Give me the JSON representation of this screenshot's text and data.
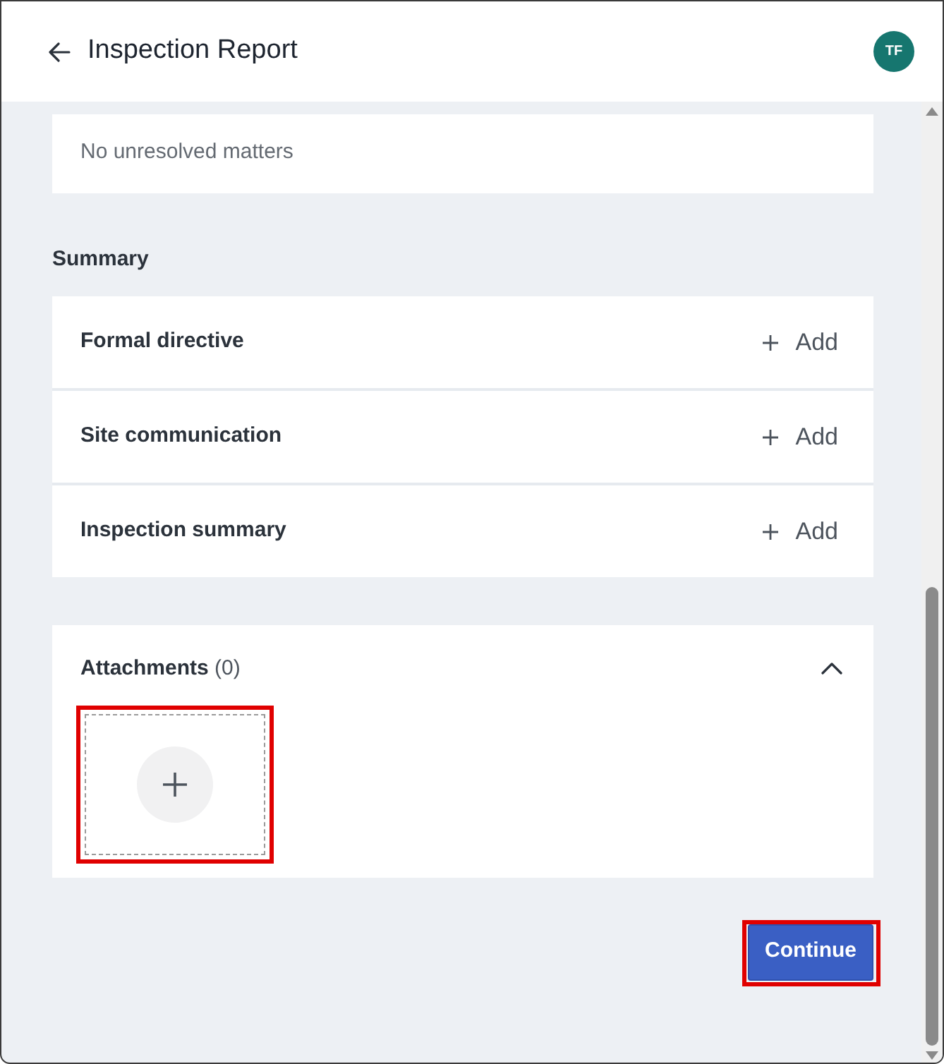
{
  "header": {
    "title": "Inspection Report",
    "avatar_initials": "TF"
  },
  "unresolved": {
    "message": "No unresolved matters"
  },
  "summary": {
    "heading": "Summary",
    "items": [
      {
        "label": "Formal directive",
        "action": "Add"
      },
      {
        "label": "Site communication",
        "action": "Add"
      },
      {
        "label": "Inspection summary",
        "action": "Add"
      }
    ]
  },
  "attachments": {
    "title": "Attachments",
    "count": "(0)",
    "expanded": true,
    "add_tile": {
      "highlighted": true
    }
  },
  "continue_button": {
    "label": "Continue",
    "highlighted": true
  }
}
